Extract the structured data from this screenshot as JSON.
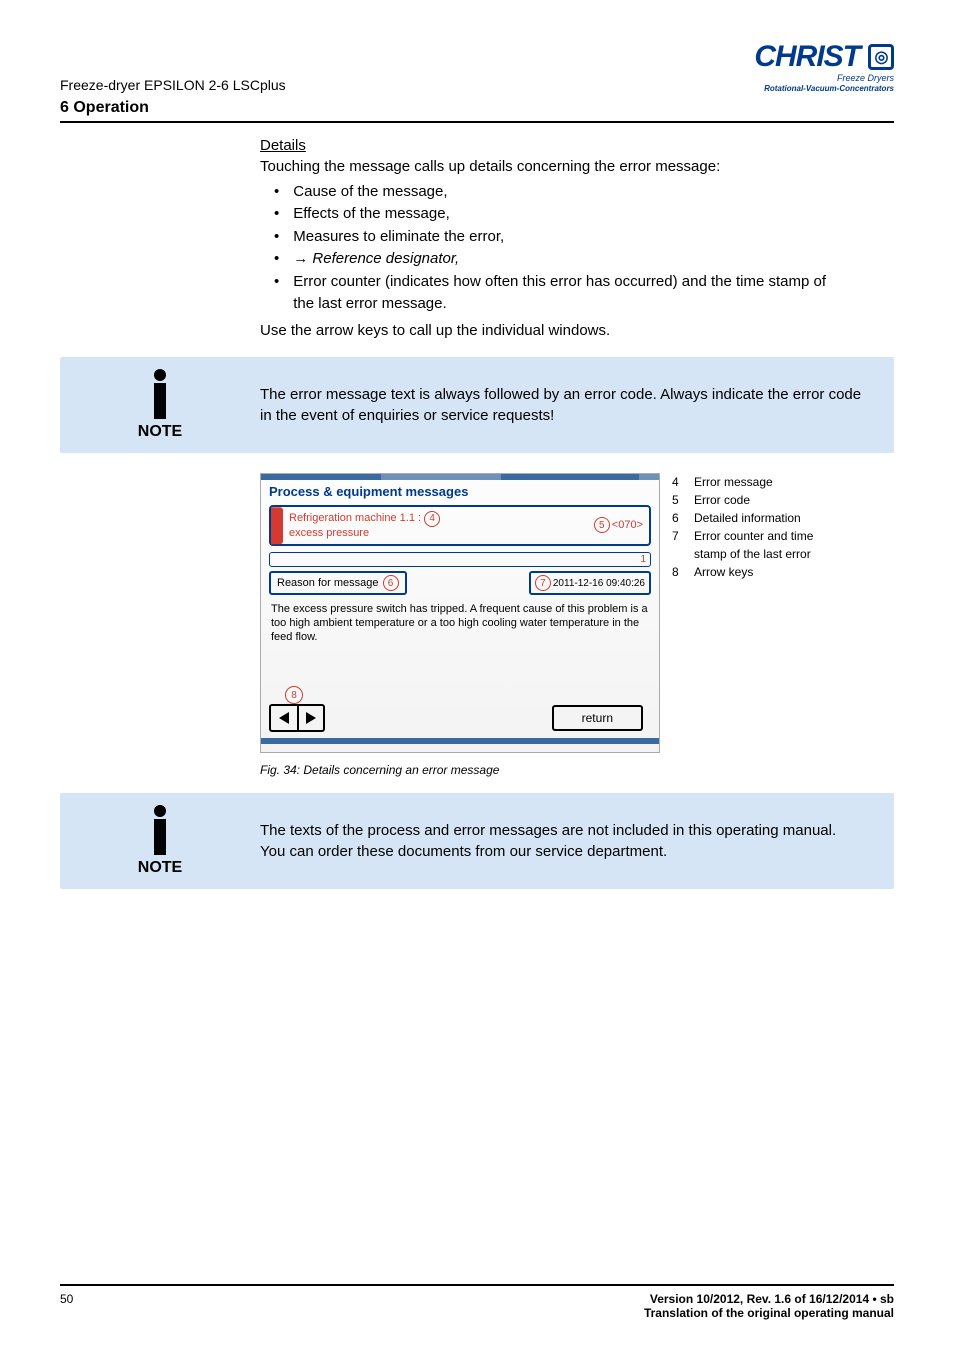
{
  "header": {
    "doc_title": "Freeze-dryer EPSILON 2-6 LSCplus",
    "logo_text": "CHRIST",
    "logo_sub1": "Freeze Dryers",
    "logo_sub2": "Rotational-Vacuum-Concentrators"
  },
  "section_heading": "6 Operation",
  "details": {
    "heading": "Details",
    "intro": "Touching the message calls up details concerning the error message:",
    "bullets": [
      "Cause of the message,",
      "Effects of the message,",
      "Measures to eliminate the error,",
      "→ Reference designator,",
      "Error counter (indicates how often this error has occurred) and the time stamp of the last error message."
    ],
    "outro": "Use the arrow keys to call up the individual windows."
  },
  "note1": {
    "label": "NOTE",
    "text": "The error message text is always followed by an error code. Always indicate the error code in the event of enquiries or service requests!"
  },
  "screenshot": {
    "title": "Process & equipment messages",
    "msg_line1": "Refrigeration machine 1.1 :",
    "msg_line2": "excess pressure",
    "code": "<070>",
    "counter": "1",
    "reason_label": "Reason for message",
    "timestamp": "2011-12-16 09:40:26",
    "description": "The excess pressure switch has tripped. A frequent cause of this problem is a too high ambient temperature or a too high cooling water temperature in the feed flow.",
    "return_label": "return",
    "callouts": {
      "c4": "4",
      "c5": "5",
      "c6": "6",
      "c7": "7",
      "c8": "8"
    }
  },
  "legend": [
    {
      "n": "4",
      "t": "Error message"
    },
    {
      "n": "5",
      "t": "Error code"
    },
    {
      "n": "6",
      "t": "Detailed information"
    },
    {
      "n": "7",
      "t": "Error counter and time stamp of the last error"
    },
    {
      "n": "8",
      "t": "Arrow keys"
    }
  ],
  "caption": "Fig. 34: Details concerning an error message",
  "note2": {
    "label": "NOTE",
    "text1": "The texts of the process and error messages are not included in this operating manual.",
    "text2": "You can order these documents from our service department."
  },
  "footer": {
    "page": "50",
    "version": "Version 10/2012, Rev. 1.6 of 16/12/2014 • sb",
    "translation": "Translation of the original operating manual"
  }
}
